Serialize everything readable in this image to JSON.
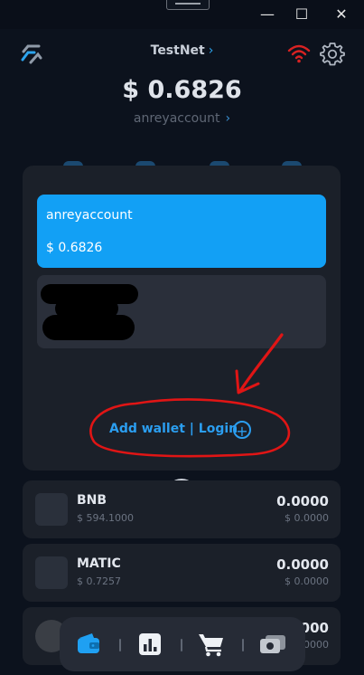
{
  "window": {
    "minimize_glyph": "—",
    "maximize_glyph": "☐",
    "close_glyph": "✕"
  },
  "header": {
    "network": "TestNet",
    "network_chevron": "›",
    "icons": [
      "logo-icon",
      "signal-icon",
      "gear-icon"
    ],
    "signal_color": "#d92222"
  },
  "balance": {
    "total": "$ 0.6826",
    "account": "anreyaccount",
    "account_chevron": "›"
  },
  "wallet_panel": {
    "active_card": {
      "name": "anreyaccount",
      "amount": "$ 0.6826",
      "color": "#12a0f5"
    },
    "add_wallet_label": "Add wallet | Login",
    "add_wallet_icon": "+"
  },
  "close_glyph": "✕",
  "tokens": [
    {
      "symbol": "BNB",
      "price": "$ 594.1000",
      "balance": "0.0000",
      "value": "$ 0.0000"
    },
    {
      "symbol": "MATIC",
      "price": "$ 0.7257",
      "balance": "0.0000",
      "value": "$ 0.0000"
    },
    {
      "symbol": "",
      "price": "",
      "balance": "0.0000",
      "value": "$ 0.0000"
    }
  ],
  "dock": {
    "items": [
      "wallet-icon",
      "chart-icon",
      "cart-icon",
      "cards-icon"
    ],
    "active_color": "#1fa0f2"
  },
  "annotation_color": "#e01515"
}
